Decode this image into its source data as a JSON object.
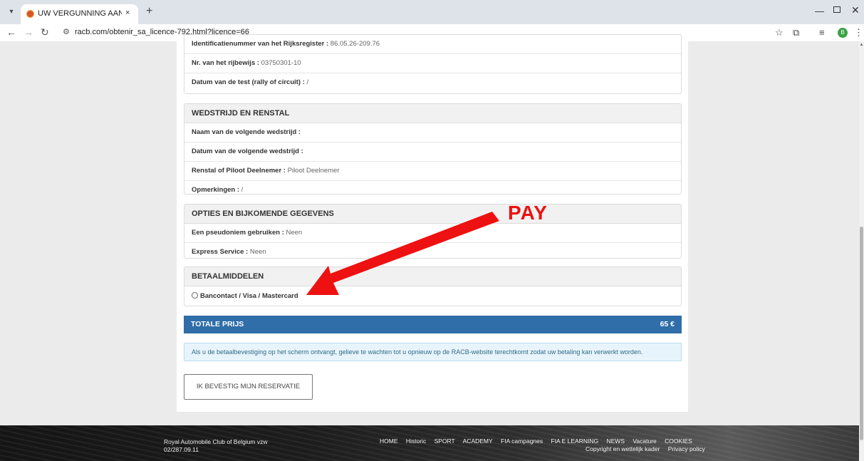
{
  "browser": {
    "tab_title": "UW VERGUNNING AANVRAGEN",
    "tab_close": "×",
    "new_tab": "+",
    "url": "racb.com/obtenir_sa_licence-792.html?licence=66",
    "profile_initial": "B",
    "icons": [
      "tab-list-icon",
      "racb-favicon",
      "close-icon",
      "plus-icon",
      "minimize-icon",
      "maximize-icon",
      "back-icon",
      "forward-icon",
      "reload-icon",
      "site-settings-icon",
      "star-icon",
      "extensions-icon",
      "reading-list-icon",
      "profile-icon",
      "more-icon"
    ]
  },
  "personal_rows": [
    {
      "label": "Identificatienummer van het Rijksregister :",
      "value": " 86.05.26-209.76"
    },
    {
      "label": "Nr. van het rijbewijs :",
      "value": " 03750301-10"
    },
    {
      "label": "Datum van de test (rally of circuit) :",
      "value": " /"
    }
  ],
  "race_panel": {
    "title": "WEDSTRIJD EN RENSTAL",
    "rows": [
      {
        "label": "Naam van de volgende wedstrijd :",
        "value": ""
      },
      {
        "label": "Datum van de volgende wedstrijd :",
        "value": ""
      },
      {
        "label": "Renstal of Piloot Deelnemer :",
        "value": " Piloot Deelnemer"
      },
      {
        "label": "Opmerkingen :",
        "value": " /"
      }
    ]
  },
  "options_panel": {
    "title": "OPTIES EN BIJKOMENDE GEGEVENS",
    "rows": [
      {
        "label": "Een pseudoniem gebruiken :",
        "value": " Neen"
      },
      {
        "label": "Express Service :",
        "value": " Neen"
      }
    ]
  },
  "payment_panel": {
    "title": "BETAALMIDDELEN",
    "option_label": "Bancontact / Visa / Mastercard"
  },
  "total": {
    "label": "TOTALE PRIJS",
    "price": "65 €"
  },
  "info_text": "Als u de betaalbevestiging op het scherm ontvangt, gelieve te wachten tot u opnieuw op de RACB-website terechtkomt zodat uw betaling kan verwerkt worden.",
  "confirm_button": "IK BEVESTIG MIJN RESERVATIE",
  "annotation": {
    "label": "PAY",
    "color": "#ee1111"
  },
  "footer": {
    "org": "Royal Automobile Club of Belgium vzw",
    "phone": "02/287.09.11",
    "nav": [
      "HOME",
      "Historic",
      "SPORT",
      "ACADEMY",
      "FIA campagnes",
      "FIA E LEARNING",
      "NEWS",
      "Vacature",
      "COOKIES"
    ],
    "legal": [
      "Copyright en wettelijk kader",
      "Privacy policy"
    ]
  },
  "colors": {
    "accent": "#2f6ea8",
    "info_bg": "#e8f4fb",
    "info_text": "#2f6a8a"
  }
}
